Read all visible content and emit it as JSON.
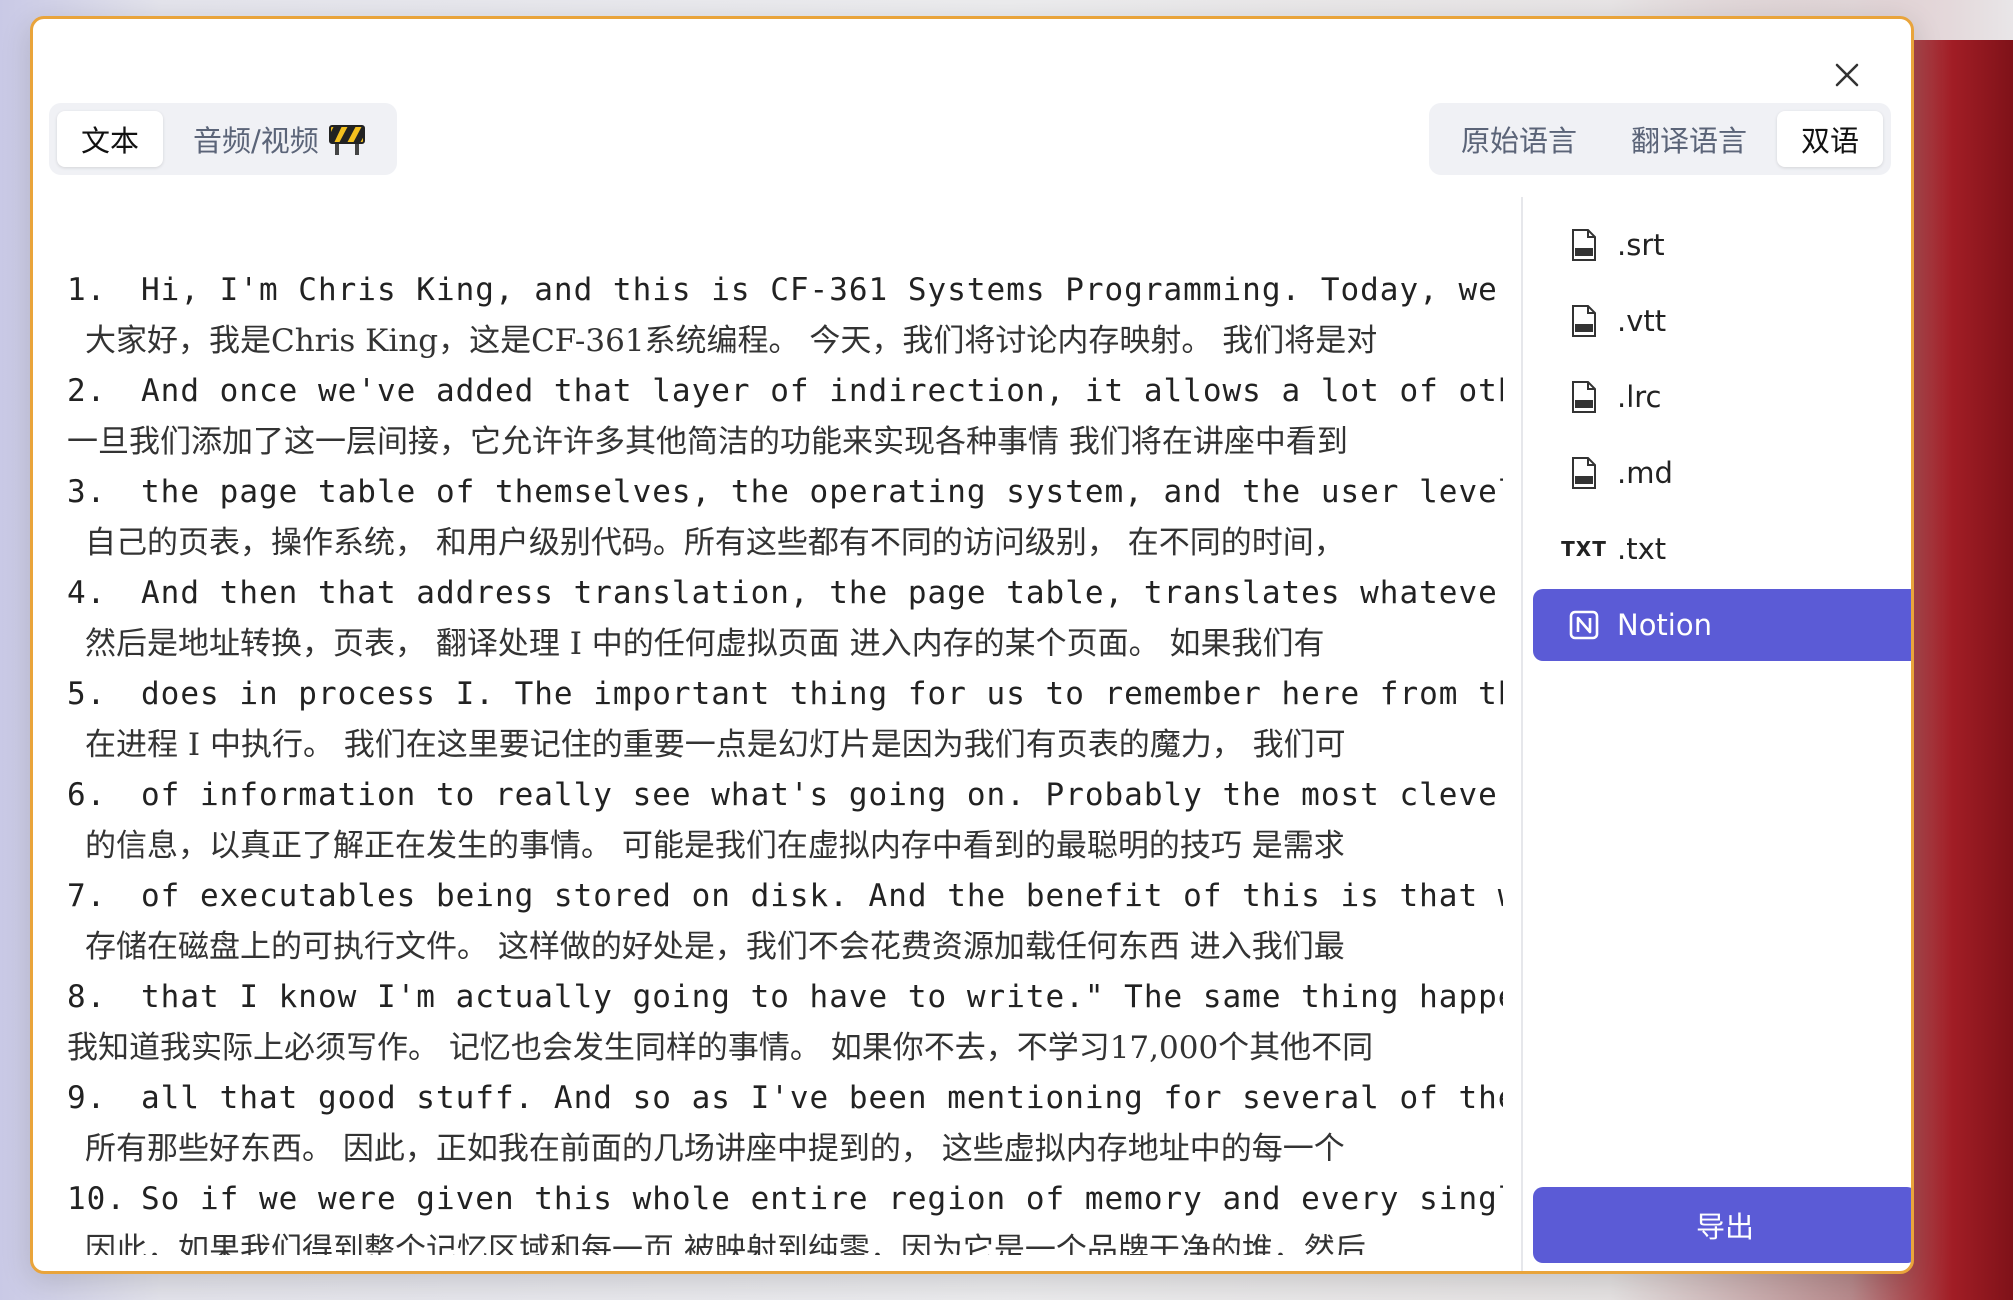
{
  "tabs": {
    "text_label": "文本",
    "audio_video_label": "音频/视频",
    "audio_video_badge_icon": "construction-sign-icon"
  },
  "language_tabs": {
    "original": "原始语言",
    "translated": "翻译语言",
    "bilingual": "双语",
    "selected": "双语"
  },
  "formats": [
    {
      "label": ".srt",
      "icon": "srt-file-icon"
    },
    {
      "label": ".vtt",
      "icon": "vtt-file-icon"
    },
    {
      "label": ".lrc",
      "icon": "lrc-file-icon"
    },
    {
      "label": ".md",
      "icon": "md-file-icon"
    },
    {
      "label": ".txt",
      "icon": "txt-icon",
      "badge": "TXT"
    },
    {
      "label": "Notion",
      "icon": "notion-icon",
      "selected": true
    }
  ],
  "export_label": "导出",
  "colors": {
    "accent": "#5b5bd6",
    "border": "#e9a43b"
  },
  "transcript": [
    {
      "num": "1.",
      "en": "Hi, I'm Chris King, and this is CF-361 Systems Programming. Today, we're",
      "zh": "大家好，我是Chris King，这是CF-361系统编程。 今天，我们将讨论内存映射。 我们将是对"
    },
    {
      "num": "2.",
      "en": "And once we've added that layer of indirection, it allows a lot of other",
      "zh": "一旦我们添加了这一层间接，它允许许多其他简洁的功能来实现各种事情 我们将在讲座中看到"
    },
    {
      "num": "3.",
      "en": "the page table of themselves, the operating system, and the user level c",
      "zh": "自己的页表，操作系统， 和用户级别代码。所有这些都有不同的访问级别， 在不同的时间，"
    },
    {
      "num": "4.",
      "en": "And then that address translation, the page table, translates whatever v",
      "zh": "然后是地址转换，页表， 翻译处理 I 中的任何虚拟页面 进入内存的某个页面。 如果我们有"
    },
    {
      "num": "5.",
      "en": "does in process I. The important thing for us to remember here from the",
      "zh": "在进程 I 中执行。 我们在这里要记住的重要一点是幻灯片是因为我们有页表的魔力， 我们可"
    },
    {
      "num": "6.",
      "en": "of information to really see what's going on. Probably the most clever t",
      "zh": "的信息，以真正了解正在发生的事情。 可能是我们在虚拟内存中看到的最聪明的技巧 是需求"
    },
    {
      "num": "7.",
      "en": "of executables being stored on disk. And the benefit of this is that we",
      "zh": "存储在磁盘上的可执行文件。 这样做的好处是，我们不会花费资源加载任何东西 进入我们最"
    },
    {
      "num": "8.",
      "en": "that I know I'm actually going to have to write.\" The same thing happens",
      "zh": "我知道我实际上必须写作。 记忆也会发生同样的事情。 如果你不去，不学习17,000个其他不同"
    },
    {
      "num": "9.",
      "en": "all that good stuff. And so as I've been mentioning for several of the p",
      "zh": "所有那些好东西。 因此，正如我在前面的几场讲座中提到的， 这些虚拟内存地址中的每一个"
    },
    {
      "num": "10.",
      "en": "So if we were given this whole entire region of memory and every single",
      "zh": "因此，如果我们得到整个记忆区域和每一页 被映射到纯零，因为它是一个品牌干净的堆，然后"
    }
  ]
}
